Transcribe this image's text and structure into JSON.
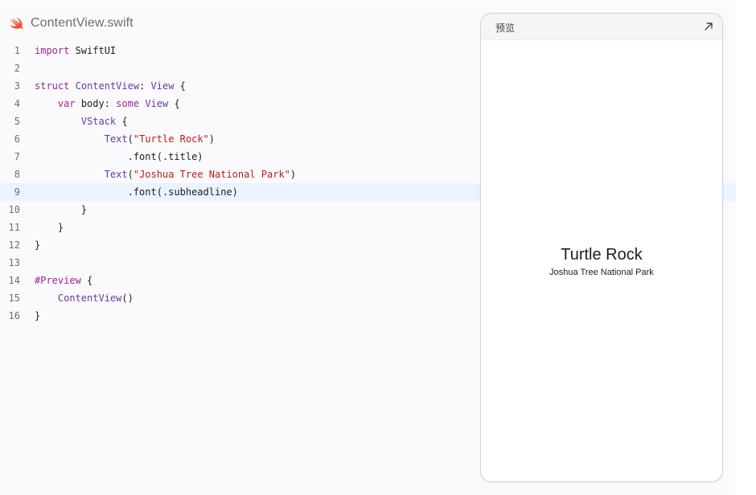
{
  "editor": {
    "filename": "ContentView.swift",
    "icon": "swift-logo-icon",
    "active_line": 9,
    "lines": [
      {
        "num": "1",
        "tokens": [
          {
            "t": "kw",
            "v": "import"
          },
          {
            "t": "pl",
            "v": " SwiftUI"
          }
        ]
      },
      {
        "num": "2",
        "tokens": []
      },
      {
        "num": "3",
        "tokens": [
          {
            "t": "kw",
            "v": "struct"
          },
          {
            "t": "pl",
            "v": " "
          },
          {
            "t": "ty",
            "v": "ContentView"
          },
          {
            "t": "pl",
            "v": ": "
          },
          {
            "t": "ty",
            "v": "View"
          },
          {
            "t": "pl",
            "v": " {"
          }
        ]
      },
      {
        "num": "4",
        "tokens": [
          {
            "t": "pl",
            "v": "    "
          },
          {
            "t": "kw",
            "v": "var"
          },
          {
            "t": "pl",
            "v": " body: "
          },
          {
            "t": "kw",
            "v": "some"
          },
          {
            "t": "pl",
            "v": " "
          },
          {
            "t": "ty",
            "v": "View"
          },
          {
            "t": "pl",
            "v": " {"
          }
        ]
      },
      {
        "num": "5",
        "tokens": [
          {
            "t": "pl",
            "v": "        "
          },
          {
            "t": "ty",
            "v": "VStack"
          },
          {
            "t": "pl",
            "v": " {"
          }
        ]
      },
      {
        "num": "6",
        "tokens": [
          {
            "t": "pl",
            "v": "            "
          },
          {
            "t": "ty",
            "v": "Text"
          },
          {
            "t": "pl",
            "v": "("
          },
          {
            "t": "str",
            "v": "\"Turtle Rock\""
          },
          {
            "t": "pl",
            "v": ")"
          }
        ]
      },
      {
        "num": "7",
        "tokens": [
          {
            "t": "pl",
            "v": "                .font(.title)"
          }
        ]
      },
      {
        "num": "8",
        "tokens": [
          {
            "t": "pl",
            "v": "            "
          },
          {
            "t": "ty",
            "v": "Text"
          },
          {
            "t": "pl",
            "v": "("
          },
          {
            "t": "str",
            "v": "\"Joshua Tree National Park\""
          },
          {
            "t": "pl",
            "v": ")"
          }
        ]
      },
      {
        "num": "9",
        "tokens": [
          {
            "t": "pl",
            "v": "                .font(.subheadline)"
          }
        ]
      },
      {
        "num": "10",
        "tokens": [
          {
            "t": "pl",
            "v": "        }"
          }
        ]
      },
      {
        "num": "11",
        "tokens": [
          {
            "t": "pl",
            "v": "    }"
          }
        ]
      },
      {
        "num": "12",
        "tokens": [
          {
            "t": "pl",
            "v": "}"
          }
        ]
      },
      {
        "num": "13",
        "tokens": []
      },
      {
        "num": "14",
        "tokens": [
          {
            "t": "kw",
            "v": "#Preview"
          },
          {
            "t": "pl",
            "v": " {"
          }
        ]
      },
      {
        "num": "15",
        "tokens": [
          {
            "t": "pl",
            "v": "    "
          },
          {
            "t": "ty",
            "v": "ContentView"
          },
          {
            "t": "pl",
            "v": "()"
          }
        ]
      },
      {
        "num": "16",
        "tokens": [
          {
            "t": "pl",
            "v": "}"
          }
        ]
      }
    ]
  },
  "preview": {
    "label": "预览",
    "expand_icon": "expand-arrow-icon",
    "title": "Turtle Rock",
    "subtitle": "Joshua Tree National Park"
  },
  "colors": {
    "keyword": "#9b2393",
    "type": "#6c36a9",
    "string": "#c41a16",
    "active_line_bg": "#eaf3fe",
    "swift_orange": "#f05138"
  }
}
